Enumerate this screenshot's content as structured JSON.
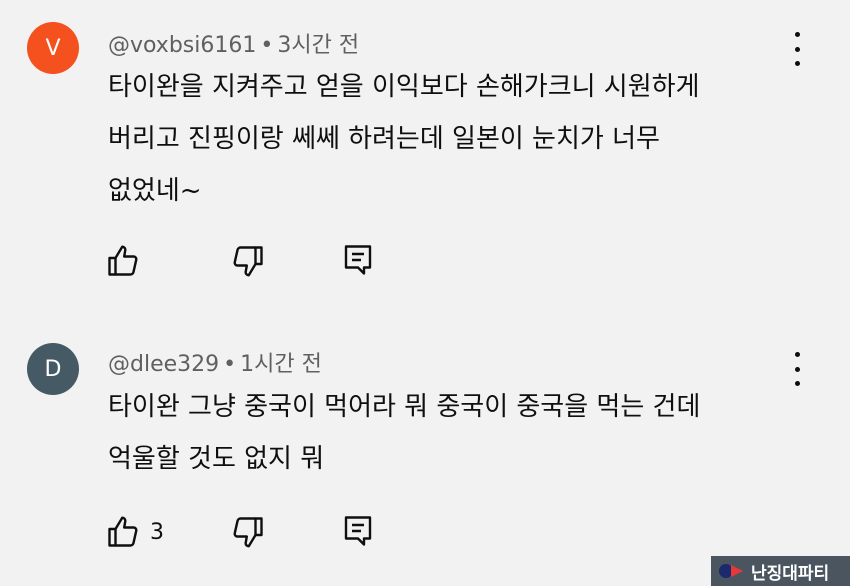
{
  "comments": [
    {
      "avatar_letter": "V",
      "avatar_color": "#f4511e",
      "author": "@voxbsi6161",
      "separator": "•",
      "time": "3시간 전",
      "lines": [
        "타이완을 지켜주고 얻을 이익보다 손해가크니 시원하게",
        "버리고 진핑이랑 쎄쎄 하려는데 일본이 눈치가 너무",
        "없었네~"
      ],
      "like_count": "",
      "icons": [
        "like-icon",
        "dislike-icon",
        "reply-icon",
        "more-icon"
      ]
    },
    {
      "avatar_letter": "D",
      "avatar_color": "#455a64",
      "author": "@dlee329",
      "separator": "•",
      "time": "1시간 전",
      "lines": [
        "타이완 그냥 중국이 먹어라 뭐 중국이 중국을 먹는 건데",
        "억울할 것도 없지 뭐"
      ],
      "like_count": "3",
      "icons": [
        "like-icon",
        "dislike-icon",
        "reply-icon",
        "more-icon"
      ]
    }
  ],
  "watermark": {
    "text": "난징대파티"
  }
}
